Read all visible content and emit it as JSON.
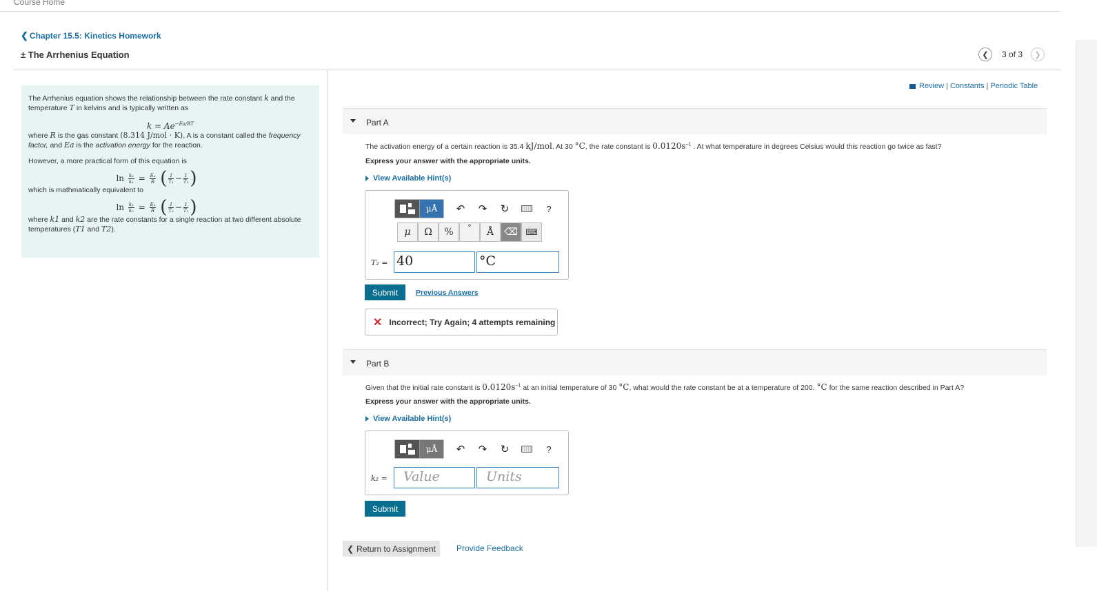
{
  "nav": {
    "course_home": "Course Home",
    "chapter_link": "Chapter 15.5: Kinetics Homework",
    "page_title": "± The Arrhenius Equation",
    "pager_count": "3 of 3"
  },
  "resources": {
    "review": "Review",
    "constants": "Constants",
    "periodic_table": "Periodic Table",
    "sep": "|"
  },
  "intro": {
    "p1a": "The Arrhenius equation shows the relationship between the rate constant",
    "p1_k": "k",
    "p1b": "and the temperature",
    "p1_T": "T",
    "p1c": "in kelvins and is typically written as",
    "eq1": "k = Ae",
    "eq1_exp": "−Ea/RT",
    "p2a": "where",
    "p2_R": "R",
    "p2b": "is the gas constant",
    "p2_val": "(8.314 J/mol · K)",
    "p2c": ", A is a constant called the",
    "p2_freq": "frequency factor,",
    "p2d": "and",
    "p2_Ea": "Ea",
    "p2e": "is the",
    "p2_act": "activation energy",
    "p2f": "for the reaction.",
    "p3": "However, a more practical form of this equation is",
    "p4": "which is mathmatically equivalent to",
    "p5a": "where",
    "p5_k1": "k1",
    "p5b": "and",
    "p5_k2": "k2",
    "p5c": "are the rate constants for a single reaction at two different absolute temperatures (",
    "p5_T1": "T1",
    "p5d": "and",
    "p5_T2": "T2",
    "p5e": ")."
  },
  "partA": {
    "label": "Part A",
    "q1": "The activation energy of a certain reaction is 35.4",
    "q1_unit": "kJ/mol",
    "q2": ". At 30",
    "q2_unit": "°C",
    "q3": ", the rate constant is",
    "q3_val": "0.0120s",
    "q3_exp": "−1",
    "q4": ". At what temperature in degrees Celsius would this reaction go twice as fast?",
    "instructions": "Express your answer with the appropriate units.",
    "hint": "View Available Hint(s)",
    "var_label": "T₂ =",
    "value": "40",
    "units": "°C",
    "submit": "Submit",
    "previous_answers": "Previous Answers",
    "feedback": "Incorrect; Try Again; 4 attempts remaining",
    "feedback_icon": "✕"
  },
  "partB": {
    "label": "Part B",
    "q1": "Given that the initial rate constant is",
    "q1_val": "0.0120s",
    "q1_exp": "−1",
    "q2": "at an initial temperature of 30",
    "q2_unit": "°C",
    "q3": ", what would the rate constant be at a temperature of 200.",
    "q3_unit": "°C",
    "q4": "for the same reaction described in Part A?",
    "instructions": "Express your answer with the appropriate units.",
    "hint": "View Available Hint(s)",
    "var_label": "k₂ =",
    "value_placeholder": "Value",
    "units_placeholder": "Units",
    "submit": "Submit"
  },
  "toolbar": {
    "mu_a": "μÅ",
    "undo": "↶",
    "redo": "↷",
    "reset": "↻",
    "help": "?",
    "mu": "μ",
    "omega": "Ω",
    "percent": "%",
    "degree": "°",
    "angstrom": "Å",
    "delete": "⌫",
    "keyboard": "⌨"
  },
  "footer": {
    "return": "Return to Assignment",
    "provide_feedback": "Provide Feedback"
  }
}
